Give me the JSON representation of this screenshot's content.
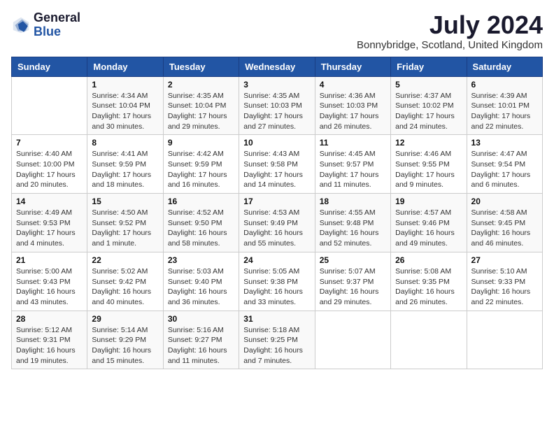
{
  "logo": {
    "general": "General",
    "blue": "Blue"
  },
  "title": {
    "month": "July 2024",
    "location": "Bonnybridge, Scotland, United Kingdom"
  },
  "weekdays": [
    "Sunday",
    "Monday",
    "Tuesday",
    "Wednesday",
    "Thursday",
    "Friday",
    "Saturday"
  ],
  "weeks": [
    [
      {
        "day": "",
        "sunrise": "",
        "sunset": "",
        "daylight": ""
      },
      {
        "day": "1",
        "sunrise": "Sunrise: 4:34 AM",
        "sunset": "Sunset: 10:04 PM",
        "daylight": "Daylight: 17 hours and 30 minutes."
      },
      {
        "day": "2",
        "sunrise": "Sunrise: 4:35 AM",
        "sunset": "Sunset: 10:04 PM",
        "daylight": "Daylight: 17 hours and 29 minutes."
      },
      {
        "day": "3",
        "sunrise": "Sunrise: 4:35 AM",
        "sunset": "Sunset: 10:03 PM",
        "daylight": "Daylight: 17 hours and 27 minutes."
      },
      {
        "day": "4",
        "sunrise": "Sunrise: 4:36 AM",
        "sunset": "Sunset: 10:03 PM",
        "daylight": "Daylight: 17 hours and 26 minutes."
      },
      {
        "day": "5",
        "sunrise": "Sunrise: 4:37 AM",
        "sunset": "Sunset: 10:02 PM",
        "daylight": "Daylight: 17 hours and 24 minutes."
      },
      {
        "day": "6",
        "sunrise": "Sunrise: 4:39 AM",
        "sunset": "Sunset: 10:01 PM",
        "daylight": "Daylight: 17 hours and 22 minutes."
      }
    ],
    [
      {
        "day": "7",
        "sunrise": "Sunrise: 4:40 AM",
        "sunset": "Sunset: 10:00 PM",
        "daylight": "Daylight: 17 hours and 20 minutes."
      },
      {
        "day": "8",
        "sunrise": "Sunrise: 4:41 AM",
        "sunset": "Sunset: 9:59 PM",
        "daylight": "Daylight: 17 hours and 18 minutes."
      },
      {
        "day": "9",
        "sunrise": "Sunrise: 4:42 AM",
        "sunset": "Sunset: 9:59 PM",
        "daylight": "Daylight: 17 hours and 16 minutes."
      },
      {
        "day": "10",
        "sunrise": "Sunrise: 4:43 AM",
        "sunset": "Sunset: 9:58 PM",
        "daylight": "Daylight: 17 hours and 14 minutes."
      },
      {
        "day": "11",
        "sunrise": "Sunrise: 4:45 AM",
        "sunset": "Sunset: 9:57 PM",
        "daylight": "Daylight: 17 hours and 11 minutes."
      },
      {
        "day": "12",
        "sunrise": "Sunrise: 4:46 AM",
        "sunset": "Sunset: 9:55 PM",
        "daylight": "Daylight: 17 hours and 9 minutes."
      },
      {
        "day": "13",
        "sunrise": "Sunrise: 4:47 AM",
        "sunset": "Sunset: 9:54 PM",
        "daylight": "Daylight: 17 hours and 6 minutes."
      }
    ],
    [
      {
        "day": "14",
        "sunrise": "Sunrise: 4:49 AM",
        "sunset": "Sunset: 9:53 PM",
        "daylight": "Daylight: 17 hours and 4 minutes."
      },
      {
        "day": "15",
        "sunrise": "Sunrise: 4:50 AM",
        "sunset": "Sunset: 9:52 PM",
        "daylight": "Daylight: 17 hours and 1 minute."
      },
      {
        "day": "16",
        "sunrise": "Sunrise: 4:52 AM",
        "sunset": "Sunset: 9:50 PM",
        "daylight": "Daylight: 16 hours and 58 minutes."
      },
      {
        "day": "17",
        "sunrise": "Sunrise: 4:53 AM",
        "sunset": "Sunset: 9:49 PM",
        "daylight": "Daylight: 16 hours and 55 minutes."
      },
      {
        "day": "18",
        "sunrise": "Sunrise: 4:55 AM",
        "sunset": "Sunset: 9:48 PM",
        "daylight": "Daylight: 16 hours and 52 minutes."
      },
      {
        "day": "19",
        "sunrise": "Sunrise: 4:57 AM",
        "sunset": "Sunset: 9:46 PM",
        "daylight": "Daylight: 16 hours and 49 minutes."
      },
      {
        "day": "20",
        "sunrise": "Sunrise: 4:58 AM",
        "sunset": "Sunset: 9:45 PM",
        "daylight": "Daylight: 16 hours and 46 minutes."
      }
    ],
    [
      {
        "day": "21",
        "sunrise": "Sunrise: 5:00 AM",
        "sunset": "Sunset: 9:43 PM",
        "daylight": "Daylight: 16 hours and 43 minutes."
      },
      {
        "day": "22",
        "sunrise": "Sunrise: 5:02 AM",
        "sunset": "Sunset: 9:42 PM",
        "daylight": "Daylight: 16 hours and 40 minutes."
      },
      {
        "day": "23",
        "sunrise": "Sunrise: 5:03 AM",
        "sunset": "Sunset: 9:40 PM",
        "daylight": "Daylight: 16 hours and 36 minutes."
      },
      {
        "day": "24",
        "sunrise": "Sunrise: 5:05 AM",
        "sunset": "Sunset: 9:38 PM",
        "daylight": "Daylight: 16 hours and 33 minutes."
      },
      {
        "day": "25",
        "sunrise": "Sunrise: 5:07 AM",
        "sunset": "Sunset: 9:37 PM",
        "daylight": "Daylight: 16 hours and 29 minutes."
      },
      {
        "day": "26",
        "sunrise": "Sunrise: 5:08 AM",
        "sunset": "Sunset: 9:35 PM",
        "daylight": "Daylight: 16 hours and 26 minutes."
      },
      {
        "day": "27",
        "sunrise": "Sunrise: 5:10 AM",
        "sunset": "Sunset: 9:33 PM",
        "daylight": "Daylight: 16 hours and 22 minutes."
      }
    ],
    [
      {
        "day": "28",
        "sunrise": "Sunrise: 5:12 AM",
        "sunset": "Sunset: 9:31 PM",
        "daylight": "Daylight: 16 hours and 19 minutes."
      },
      {
        "day": "29",
        "sunrise": "Sunrise: 5:14 AM",
        "sunset": "Sunset: 9:29 PM",
        "daylight": "Daylight: 16 hours and 15 minutes."
      },
      {
        "day": "30",
        "sunrise": "Sunrise: 5:16 AM",
        "sunset": "Sunset: 9:27 PM",
        "daylight": "Daylight: 16 hours and 11 minutes."
      },
      {
        "day": "31",
        "sunrise": "Sunrise: 5:18 AM",
        "sunset": "Sunset: 9:25 PM",
        "daylight": "Daylight: 16 hours and 7 minutes."
      },
      {
        "day": "",
        "sunrise": "",
        "sunset": "",
        "daylight": ""
      },
      {
        "day": "",
        "sunrise": "",
        "sunset": "",
        "daylight": ""
      },
      {
        "day": "",
        "sunrise": "",
        "sunset": "",
        "daylight": ""
      }
    ]
  ]
}
